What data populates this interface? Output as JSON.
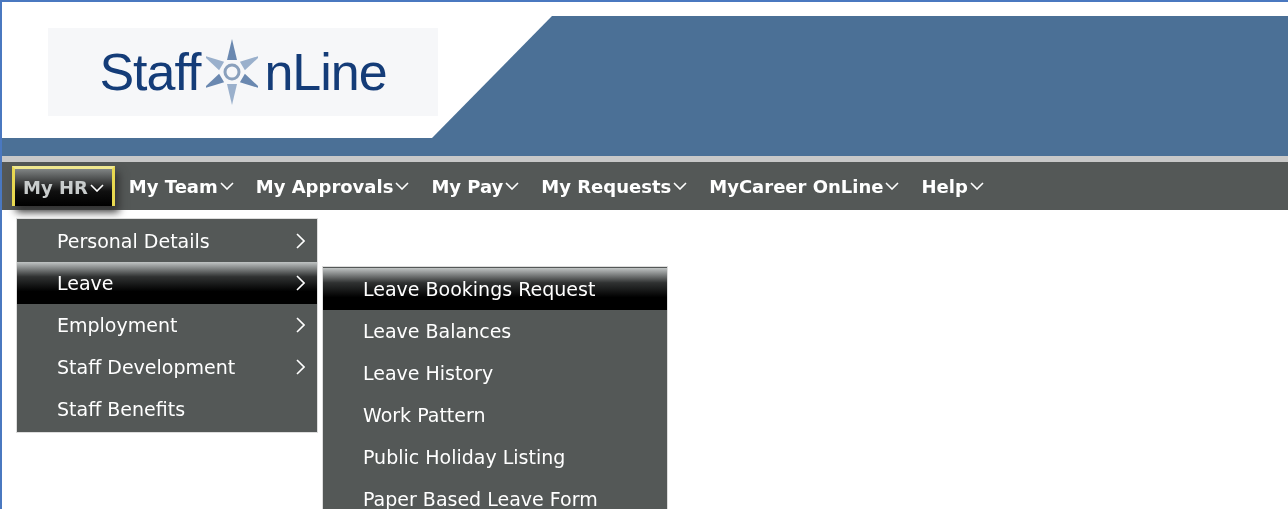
{
  "logo": {
    "left": "Staff",
    "right": "nLine"
  },
  "nav": [
    {
      "label": "My HR",
      "selected": true
    },
    {
      "label": "My Team",
      "selected": false
    },
    {
      "label": "My Approvals",
      "selected": false
    },
    {
      "label": "My Pay",
      "selected": false
    },
    {
      "label": "My Requests",
      "selected": false
    },
    {
      "label": "MyCareer OnLine",
      "selected": false
    },
    {
      "label": "Help",
      "selected": false
    }
  ],
  "menu": [
    {
      "label": "Personal Details",
      "has_submenu": true,
      "selected": false
    },
    {
      "label": "Leave",
      "has_submenu": true,
      "selected": true
    },
    {
      "label": "Employment",
      "has_submenu": true,
      "selected": false
    },
    {
      "label": "Staff Development",
      "has_submenu": true,
      "selected": false
    },
    {
      "label": "Staff Benefits",
      "has_submenu": false,
      "selected": false
    }
  ],
  "submenu": [
    {
      "label": "Leave Bookings Request",
      "selected": true
    },
    {
      "label": "Leave Balances",
      "selected": false
    },
    {
      "label": "Leave History",
      "selected": false
    },
    {
      "label": "Work Pattern",
      "selected": false
    },
    {
      "label": "Public Holiday Listing",
      "selected": false
    },
    {
      "label": "Paper Based Leave Form",
      "selected": false
    }
  ]
}
